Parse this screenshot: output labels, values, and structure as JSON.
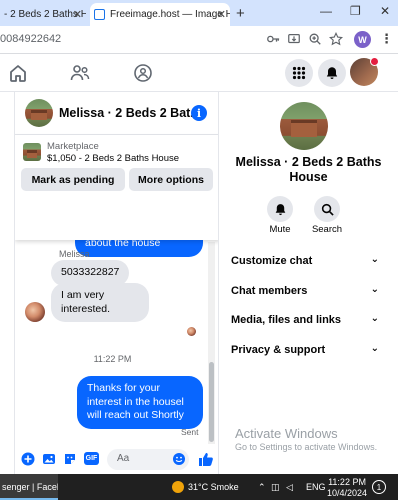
{
  "browser": {
    "tabs": [
      {
        "label": "- 2 Beds 2 Baths H"
      },
      {
        "label": "Freeimage.host — Image Hosti"
      }
    ],
    "new_tab_label": "+",
    "url": "0084922642",
    "profile_initial": "W"
  },
  "chat": {
    "title": "Melissa · 2 Beds 2 Bat...",
    "marketplace_label": "Marketplace",
    "listing_detail": "$1,050 - 2 Beds 2 Baths House",
    "mark_pending_label": "Mark as pending",
    "more_options_label": "More options",
    "messages": {
      "out_top": "can send you details and requirements about the house",
      "sender_name": "Melissa",
      "in_phone": "5033322827",
      "in_interest": "I am very interested.",
      "timestamp": "11:22 PM",
      "out_reply": "Thanks for your interest in the housel will reach out Shortly",
      "sent_status": "Sent"
    },
    "composer_placeholder": "Aa"
  },
  "info_panel": {
    "title": "Melissa · 2 Beds 2 Baths House",
    "mute_label": "Mute",
    "search_label": "Search",
    "menu": [
      {
        "label": "Customize chat"
      },
      {
        "label": "Chat members"
      },
      {
        "label": "Media, files and links"
      },
      {
        "label": "Privacy & support"
      }
    ]
  },
  "watermark": {
    "title": "Activate Windows",
    "subtitle": "Go to Settings to activate Windows."
  },
  "taskbar": {
    "app_label": "senger | Facebo...",
    "weather": "31°C  Smoke",
    "lang": "ENG",
    "time": "11:22 PM",
    "date": "10/4/2024",
    "notifications": "1"
  },
  "colors": {
    "messenger_blue": "#0866ff",
    "bubble_gray": "#e4e6eb",
    "taskbar": "#202020"
  }
}
